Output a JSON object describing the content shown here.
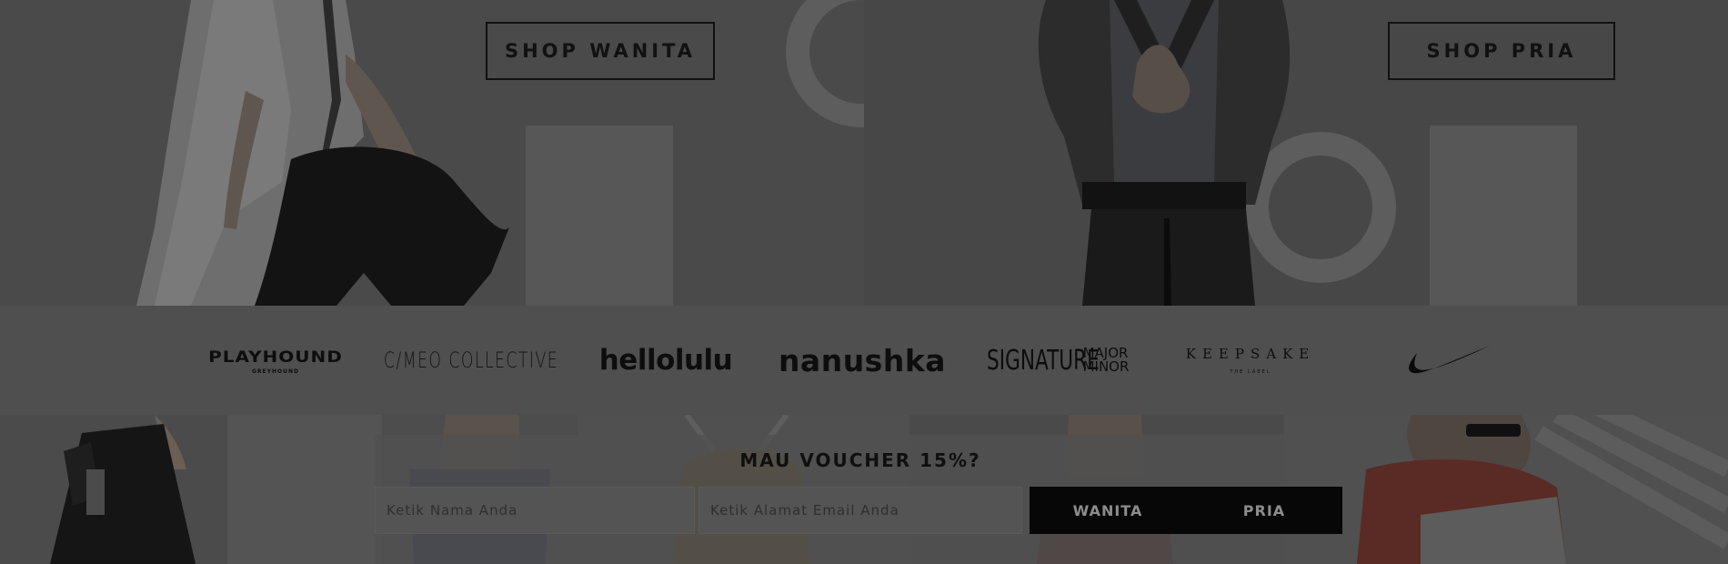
{
  "hero": {
    "shop_women_label": "SHOP WANITA",
    "shop_men_label": "SHOP PRIA"
  },
  "brands": [
    {
      "name": "PLAYHOUND",
      "sub": "GREYHOUND"
    },
    {
      "name": "C/MEO COLLECTIVE"
    },
    {
      "name": "hellolulu"
    },
    {
      "name": "nanushka"
    },
    {
      "name": "SIGNATURE",
      "line1": "MAJOR",
      "line2": "MINOR"
    },
    {
      "name": "KEEPSAKE",
      "sub": "THE LABEL"
    },
    {
      "name": "Nike",
      "icon": "nike-swoosh-icon"
    }
  ],
  "voucher": {
    "title": "MAU VOUCHER 15%?",
    "name_placeholder": "Ketik Nama Anda",
    "email_placeholder": "Ketik Alamat Email Anda",
    "women_button": "WANITA",
    "men_button": "PRIA"
  },
  "colors": {
    "overlay": "#4f4f4f",
    "text_dark": "#111111",
    "button_bar": "#070707"
  }
}
